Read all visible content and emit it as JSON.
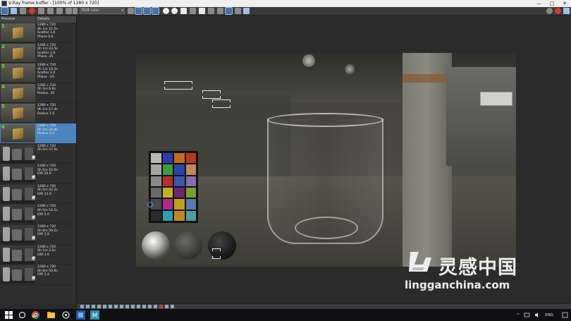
{
  "window": {
    "title": "V-Ray frame buffer - [100% of 1280 x 720]",
    "controls": [
      "—",
      "□",
      "✕"
    ]
  },
  "toolbar": {
    "channel": "RGB color"
  },
  "panel": {
    "col_preview": "Preview",
    "col_details": "Details",
    "items": [
      {
        "num": "1",
        "details": "1280 x 720\n0h 1m 21.5s\nScatter 1.0\nPhase 0.0"
      },
      {
        "num": "2",
        "details": "1280 x 720\n0h 1m 23.5s\nScatter 2.0\nPhase .45"
      },
      {
        "num": "3",
        "details": "1280 x 720\n0h 1m 19.5s\nScatter 2.0\nPhase -.05"
      },
      {
        "num": "4",
        "details": "1280 x 720\n0h 1m 6.0s\nRadius .35"
      },
      {
        "num": "5",
        "details": "1280 x 720\n0h 1m 17.4s\nRadius 1.0"
      },
      {
        "num": "6",
        "details": "1280 x 720\n0h 1m 20.9s\nRadius 2.0"
      },
      {
        "num": "",
        "details": "1280 x 720\n0h 0m 47.0s"
      },
      {
        "num": "",
        "details": "1280 x 720\n0h 0m 42.0s\nIOR 20.0"
      },
      {
        "num": "",
        "details": "1280 x 720\n0h 0m 42.2s\nIOR 12.0"
      },
      {
        "num": "",
        "details": "1280 x 720\n0h 0m 54.5s\nIOR 5.0"
      },
      {
        "num": "",
        "details": "1280 x 720\n0h 0m 59.2s\nIOR 1.8"
      },
      {
        "num": "",
        "details": "1280 x 720\n0h 1m 2.6s\nIOR 1.6"
      },
      {
        "num": "",
        "details": "1280 x 720\n0h 0m 50.6s\nIOR 1.4"
      }
    ]
  },
  "checker_colors": [
    "#b9b9b9",
    "#2f3db0",
    "#c66a1e",
    "#b43a1e",
    "#a4a4a4",
    "#3a9b42",
    "#2a44a8",
    "#c08a58",
    "#8a8a8a",
    "#b0302a",
    "#3a5aa8",
    "#8a6ab0",
    "#6a6a6a",
    "#c0b020",
    "#6a2a6a",
    "#7aa030",
    "#4a4a4a",
    "#b02a8a",
    "#c0a020",
    "#5a7ab0",
    "#2a2a2a",
    "#2aa0b0",
    "#c08a20",
    "#4aa0a0"
  ],
  "watermark": {
    "cn": "灵感中国",
    "url": "lingganchina.com"
  },
  "taskbar": {
    "lang": "ENG",
    "time": "",
    "caret": "^"
  }
}
